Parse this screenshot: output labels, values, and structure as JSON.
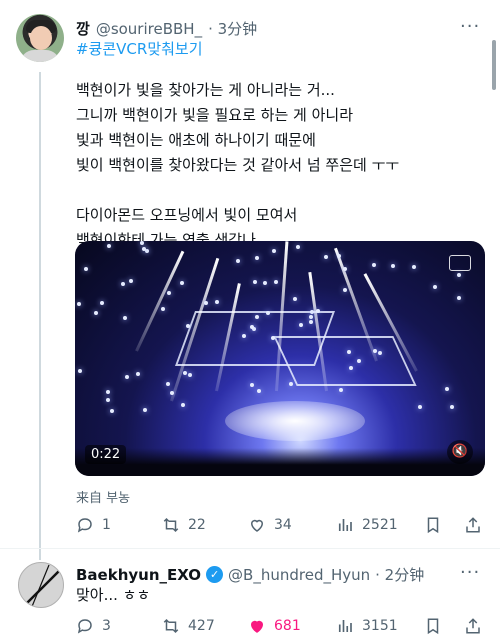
{
  "tweet": {
    "display_name": "깡",
    "handle": "@sourireBBH_",
    "time": "· 3分钟",
    "hashtag": "#큥콘VCR맞춰보기",
    "lines": [
      "백현이가 빛을 찾아가는 게 아니라는 거...",
      "그니까 백현이가 빛을 필요로 하는 게 아니라",
      "빛과 백현이는 애초에 하나이기 때문에",
      "빛이 백현이를 찾아왔다는 것 같아서 넘 쭈은데 ㅜㅜ"
    ],
    "lines2": [
      "다이아몬드 오프닝에서 빛이 모여서",
      "백현이한테 가는 연출 생각나.."
    ],
    "video": {
      "duration": "0:22"
    },
    "source": "来自 부농",
    "stats": {
      "replies": "1",
      "retweets": "22",
      "likes": "34",
      "views": "2521"
    }
  },
  "reply": {
    "display_name": "Baekhyun_EXO",
    "handle": "@B_hundred_Hyun",
    "time": "· 2分钟",
    "text": "맞아... ㅎㅎ",
    "stats": {
      "replies": "3",
      "retweets": "427",
      "likes": "681",
      "views": "3151"
    }
  },
  "colors": {
    "accent": "#1d9bf0",
    "like": "#f91880",
    "muted": "#536471"
  }
}
